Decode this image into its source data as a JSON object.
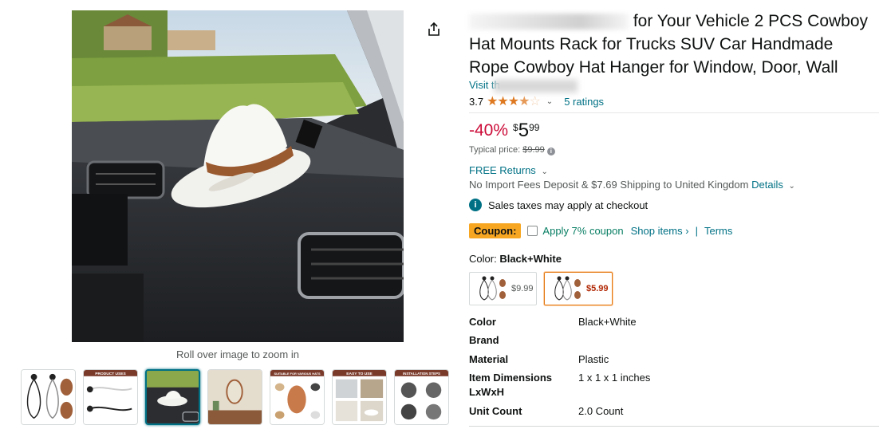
{
  "product": {
    "title_part1": "for Your Vehicle 2 PCS Cowboy",
    "title_part2": "Hat Mounts Rack for Trucks SUV Car Handmade",
    "title_part3": "Rope Cowboy Hat Hanger for Window, Door, Wall",
    "visit_store": "Visit th",
    "rating_value": "3.7",
    "rating_stars": 3.7,
    "ratings_count": "5 ratings"
  },
  "main_image": {
    "zoom_hint": "Roll over image to zoom in"
  },
  "thumbnails": [
    {
      "label": ""
    },
    {
      "label": "PRODUCT USES"
    },
    {
      "label": ""
    },
    {
      "label": ""
    },
    {
      "label": "SUITABLE FOR VARIOUS HATS"
    },
    {
      "label": "EASY TO USE"
    },
    {
      "label": "INSTALLATION STEPS"
    }
  ],
  "pricing": {
    "discount": "-40%",
    "currency": "$",
    "whole": "5",
    "fraction": "99",
    "typical_label": "Typical price:",
    "typical_price": "$9.99"
  },
  "shipping": {
    "returns": "FREE Returns",
    "import_text": "No Import Fees Deposit & $7.69 Shipping to United Kingdom",
    "details_link": "Details",
    "tax_notice": "Sales taxes may apply at checkout"
  },
  "coupon": {
    "badge": "Coupon:",
    "apply": "Apply 7% coupon",
    "shop_items": "Shop items ›",
    "separator": "|",
    "terms": "Terms"
  },
  "variant": {
    "label": "Color:",
    "selected": "Black+White",
    "options": [
      {
        "price": "$9.99",
        "selected": false
      },
      {
        "price": "$5.99",
        "selected": true
      }
    ]
  },
  "specs": [
    {
      "key": "Color",
      "value": "Black+White"
    },
    {
      "key": "Brand",
      "value": ""
    },
    {
      "key": "Material",
      "value": "Plastic"
    },
    {
      "key": "Item Dimensions LxWxH",
      "value": "1 x 1 x 1 inches"
    },
    {
      "key": "Unit Count",
      "value": "2.0 Count"
    }
  ],
  "colors": {
    "link": "#007185",
    "discount": "#cc0c39",
    "star": "#de7921",
    "coupon_badge": "#f7a622",
    "coupon_apply": "#067d62",
    "selected_border": "#e47911"
  }
}
